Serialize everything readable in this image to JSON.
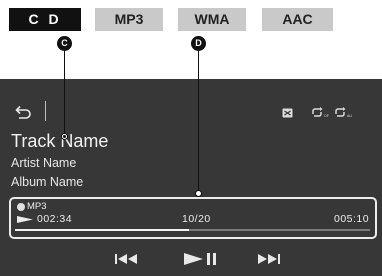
{
  "tabs": [
    {
      "label": "C D",
      "active": true
    },
    {
      "label": "MP3",
      "active": false
    },
    {
      "label": "WMA",
      "active": false
    },
    {
      "label": "AAC",
      "active": false
    }
  ],
  "callouts": {
    "c": "C",
    "d": "D"
  },
  "player": {
    "track_name": "Track Name",
    "artist_name": "Artist Name",
    "album_name": "Album Name",
    "format": "MP3",
    "elapsed": "002:34",
    "track_counter": "10/20",
    "total": "005:10",
    "progress": 0.49
  },
  "icons": {
    "back": "back-arrow-icon",
    "shuffle": "shuffle-icon",
    "repeat_off": "repeat-off-icon",
    "repeat_all": "repeat-all-icon",
    "prev": "previous-track-icon",
    "play_pause": "play-pause-icon",
    "next": "next-track-icon"
  },
  "colors": {
    "screen_bg": "#373737",
    "active_tab": "#111111",
    "inactive_tab": "#c9c9c9",
    "text": "#f2f2f2"
  }
}
